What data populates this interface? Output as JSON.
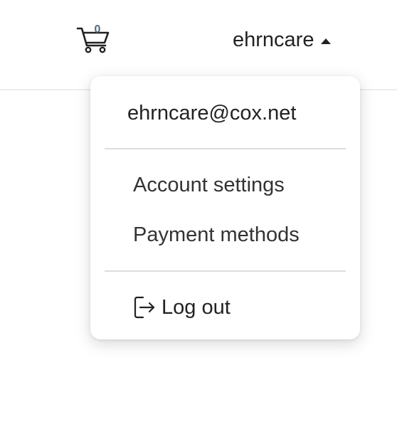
{
  "header": {
    "cart": {
      "icon": "shopping-cart-icon",
      "count": "0",
      "count_color": "#4b6a88"
    },
    "user": {
      "name": "ehrncare",
      "caret_icon": "caret-up-icon"
    }
  },
  "user_menu": {
    "email": "ehrncare@cox.net",
    "items": [
      {
        "label": "Account settings"
      },
      {
        "label": "Payment methods"
      }
    ],
    "logout": {
      "icon": "logout-icon",
      "label": "Log out"
    }
  }
}
